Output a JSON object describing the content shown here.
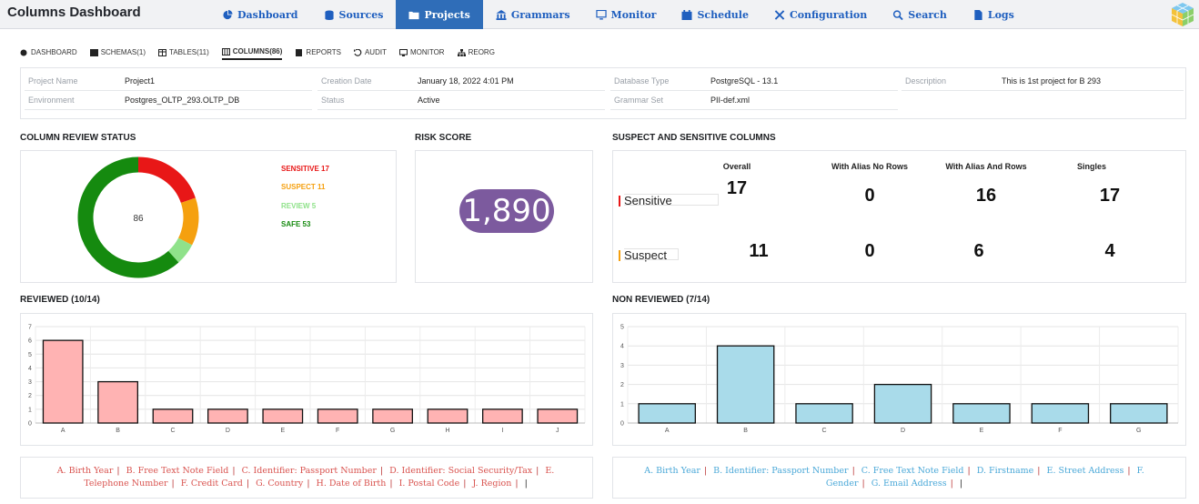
{
  "app": {
    "title": "Columns Dashboard"
  },
  "nav": [
    {
      "label": "Dashboard",
      "icon": "dashboard-pie-icon",
      "active": false
    },
    {
      "label": "Sources",
      "icon": "database-icon",
      "active": false
    },
    {
      "label": "Projects",
      "icon": "folder-icon",
      "active": true
    },
    {
      "label": "Grammars",
      "icon": "bank-icon",
      "active": false
    },
    {
      "label": "Monitor",
      "icon": "monitor-icon",
      "active": false
    },
    {
      "label": "Schedule",
      "icon": "calendar-icon",
      "active": false
    },
    {
      "label": "Configuration",
      "icon": "tools-icon",
      "active": false
    },
    {
      "label": "Search",
      "icon": "search-icon",
      "active": false
    },
    {
      "label": "Logs",
      "icon": "file-icon",
      "active": false
    }
  ],
  "subnav": [
    {
      "label": "DASHBOARD",
      "active": false
    },
    {
      "label": "SCHEMAS(1)",
      "active": false
    },
    {
      "label": "TABLES(11)",
      "active": false
    },
    {
      "label": "COLUMNS(86)",
      "active": true
    },
    {
      "label": "REPORTS",
      "active": false
    },
    {
      "label": "AUDIT",
      "active": false
    },
    {
      "label": "MONITOR",
      "active": false
    },
    {
      "label": "REORG",
      "active": false
    }
  ],
  "project": {
    "name_label": "Project Name",
    "name": "Project1",
    "env_label": "Environment",
    "env": "Postgres_OLTP_293.OLTP_DB",
    "created_label": "Creation Date",
    "created": "January 18, 2022 4:01 PM",
    "status_label": "Status",
    "status": "Active",
    "dbtype_label": "Database Type",
    "dbtype": "PostgreSQL - 13.1",
    "grammar_label": "Grammar Set",
    "grammar": "PII-def.xml",
    "desc_label": "Description",
    "desc": "This is 1st project for B 293"
  },
  "review_status": {
    "title": "COLUMN REVIEW STATUS",
    "center_label": "86",
    "colors": {
      "sensitive": "#e81717",
      "suspect": "#f5a00f",
      "review": "#8fe28a",
      "safe": "#158a0f"
    },
    "legend": {
      "sensitive": "SENSITIVE 17",
      "suspect": "SUSPECT 11",
      "review": "REVIEW 5",
      "safe": "SAFE 53"
    }
  },
  "risk": {
    "title": "RISK SCORE",
    "value": "1,890"
  },
  "suspect_sensitive": {
    "title": "SUSPECT AND SENSITIVE COLUMNS",
    "headers": [
      "Overall",
      "With Alias No Rows",
      "With Alias And Rows",
      "Singles"
    ],
    "rows": [
      {
        "label": "Sensitive",
        "color": "#e81717",
        "values": [
          "17",
          "0",
          "16",
          "17"
        ]
      },
      {
        "label": "Suspect",
        "color": "#f5a00f",
        "values": [
          "11",
          "0",
          "6",
          "4"
        ]
      }
    ]
  },
  "reviewed": {
    "title": "REVIEWED (10/14)",
    "note_color": "#d9534f",
    "notes": [
      "A. Birth Year",
      "B. Free Text Note Field",
      "C. Identifier: Passport Number",
      "D. Identifier: Social Security/Tax",
      "E. Telephone Number",
      "F. Credit Card",
      "G. Country",
      "H. Date of Birth",
      "I. Postal Code",
      "J. Region"
    ]
  },
  "non_reviewed": {
    "title": "NON REVIEWED (7/14)",
    "note_color": "#4aa8d8",
    "notes": [
      "A. Birth Year",
      "B. Identifier: Passport Number",
      "C. Free Text Note Field",
      "D. Firstname",
      "E. Street Address",
      "F. Gender",
      "G. Email Address"
    ]
  },
  "chart_data": [
    {
      "type": "donut",
      "categories": [
        "Sensitive",
        "Suspect",
        "Review",
        "Safe"
      ],
      "values": [
        17,
        11,
        5,
        53
      ],
      "total": 86
    },
    {
      "type": "bar",
      "categories": [
        "A",
        "B",
        "C",
        "D",
        "E",
        "F",
        "G",
        "H",
        "I",
        "J"
      ],
      "values": [
        6,
        3,
        1,
        1,
        1,
        1,
        1,
        1,
        1,
        1
      ],
      "ylim": [
        0,
        7
      ],
      "yticks": [
        0,
        1,
        2,
        3,
        4,
        5,
        6,
        7
      ],
      "fill": "#ffb3b3",
      "grid": true
    },
    {
      "type": "bar",
      "categories": [
        "A",
        "B",
        "C",
        "D",
        "E",
        "F",
        "G"
      ],
      "values": [
        1,
        4,
        1,
        2,
        1,
        1,
        1
      ],
      "ylim": [
        0,
        5
      ],
      "yticks": [
        0,
        1,
        2,
        3,
        4,
        5
      ],
      "fill": "#a9dbea",
      "grid": true
    }
  ]
}
